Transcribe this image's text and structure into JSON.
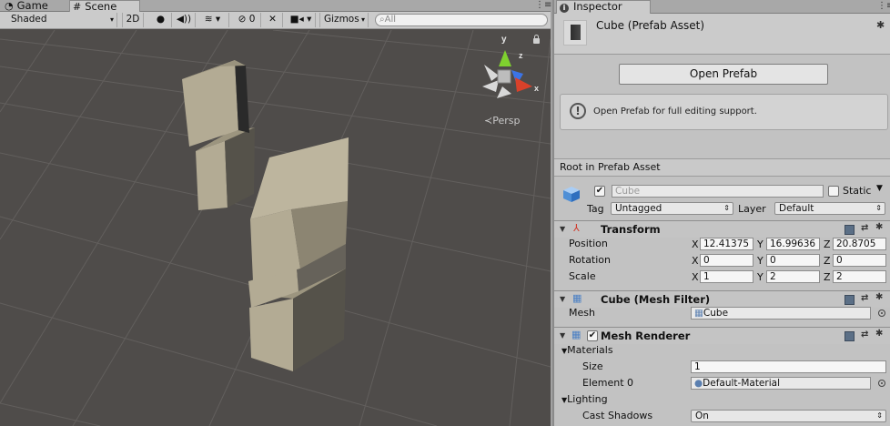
{
  "scene_window": {
    "tabs": [
      {
        "label": "Game",
        "icon": "game-icon",
        "active": false
      },
      {
        "label": "Scene",
        "icon": "scene-icon",
        "active": true
      }
    ],
    "toolbar": {
      "draw_mode": "Shaded",
      "mode_2d": "2D",
      "hidden_count": "0",
      "gizmos": "Gizmos",
      "search_placeholder": "All"
    },
    "projection": "Persp",
    "gizmo_axes": {
      "y": "y",
      "z": "z",
      "x": "x"
    }
  },
  "inspector": {
    "tab": "Inspector",
    "title": "Cube (Prefab Asset)",
    "open_prefab_button": "Open Prefab",
    "help_text": "Open Prefab for full editing support.",
    "root_label": "Root in Prefab Asset",
    "gameobject": {
      "active": true,
      "name": "Cube",
      "static_label": "Static",
      "static": false,
      "tag_label": "Tag",
      "tag": "Untagged",
      "layer_label": "Layer",
      "layer": "Default"
    },
    "transform": {
      "title": "Transform",
      "rows": [
        {
          "label": "Position",
          "x": "12.41375",
          "y": "16.99636",
          "z": "20.8705"
        },
        {
          "label": "Rotation",
          "x": "0",
          "y": "0",
          "z": "0"
        },
        {
          "label": "Scale",
          "x": "1",
          "y": "2",
          "z": "2"
        }
      ],
      "axis_labels": [
        "X",
        "Y",
        "Z"
      ]
    },
    "mesh_filter": {
      "title": "Cube (Mesh Filter)",
      "mesh_label": "Mesh",
      "mesh_value": "Cube"
    },
    "mesh_renderer": {
      "title": "Mesh Renderer",
      "enabled": true,
      "materials_label": "Materials",
      "size_label": "Size",
      "size_value": "1",
      "element0_label": "Element 0",
      "element0_value": "Default-Material",
      "lighting_label": "Lighting",
      "cast_shadows_label": "Cast Shadows",
      "cast_shadows_value": "On"
    }
  },
  "colors": {
    "viewport_bg": "#4f4c4a",
    "grid": "#625f5d",
    "cube_light": "#b3ab94",
    "cube_mid": "#8f8874",
    "cube_dark": "#55524a",
    "gizmo_x": "#d9412a",
    "gizmo_y": "#7fd12f",
    "gizmo_z": "#3c74e6"
  }
}
